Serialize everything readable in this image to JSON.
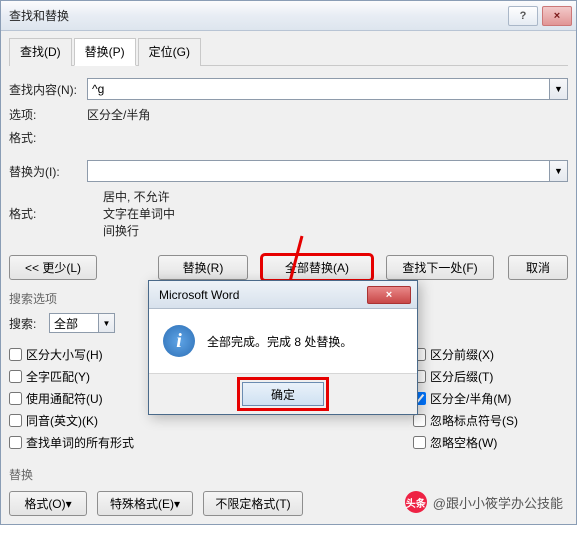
{
  "window": {
    "title": "查找和替换",
    "help": "?",
    "close": "×"
  },
  "tabs": {
    "find": "查找(D)",
    "replace": "替换(P)",
    "goto": "定位(G)"
  },
  "find": {
    "label": "查找内容(N):",
    "value": "^g"
  },
  "options_label": "选项:",
  "options_value": "区分全/半角",
  "format_label": "格式:",
  "replace": {
    "label": "替换为(I):",
    "value": ""
  },
  "replace_note": "居中, 不允许文字在单词中间换行",
  "buttons": {
    "less": "<< 更少(L)",
    "replace_one": "替换(R)",
    "replace_all": "全部替换(A)",
    "find_next": "查找下一处(F)",
    "cancel": "取消"
  },
  "search_section": "搜索选项",
  "search_label": "搜索:",
  "search_value": "全部",
  "checks_left": [
    "区分大小写(H)",
    "全字匹配(Y)",
    "使用通配符(U)",
    "同音(英文)(K)",
    "查找单词的所有形式"
  ],
  "checks_right": [
    {
      "label": "区分前缀(X)",
      "checked": false
    },
    {
      "label": "区分后缀(T)",
      "checked": false
    },
    {
      "label": "区分全/半角(M)",
      "checked": true
    },
    {
      "label": "忽略标点符号(S)",
      "checked": false
    },
    {
      "label": "忽略空格(W)",
      "checked": false
    }
  ],
  "replace_section": "替换",
  "footer_buttons": {
    "format": "格式(O)",
    "special": "特殊格式(E)",
    "noformat": "不限定格式(T)"
  },
  "msgbox": {
    "title": "Microsoft Word",
    "text": "全部完成。完成 8 处替换。",
    "ok": "确定",
    "close": "×"
  },
  "watermark": {
    "prefix": "头条",
    "text": "@跟小小筱学办公技能"
  }
}
